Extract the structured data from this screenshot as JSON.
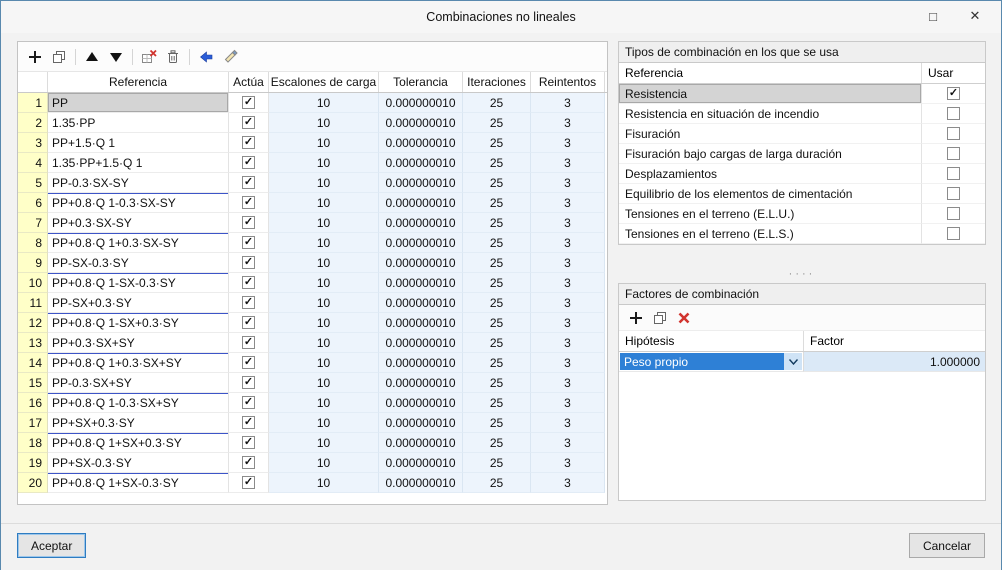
{
  "window": {
    "title": "Combinaciones no lineales",
    "maximize_icon": "□",
    "close_icon": "✕"
  },
  "colors": {
    "accent_blue": "#2e80d6",
    "row_number_bg": "#ffffc8",
    "selection_gray": "#d4d4d4",
    "boxed_border": "#3d55c8",
    "numeric_cell_bg": "#edf4fc"
  },
  "left": {
    "toolbar_icons": [
      "add-icon",
      "duplicate-icon",
      "move-up-icon",
      "move-down-icon",
      "delete-rows-icon",
      "trash-icon",
      "undo-arrow-icon",
      "format-painter-icon"
    ],
    "columns": {
      "referencia": "Referencia",
      "actua": "Actúa",
      "escalones": "Escalones de carga",
      "tolerancia": "Tolerancia",
      "iteraciones": "Iteraciones",
      "reintentos": "Reintentos"
    },
    "rows": [
      {
        "num": "1",
        "ref": "PP",
        "actua": true,
        "escalones": "10",
        "tolerancia": "0.000000010",
        "iteraciones": "25",
        "reintentos": "3",
        "boxed": false,
        "selected": true
      },
      {
        "num": "2",
        "ref": "1.35·PP",
        "actua": true,
        "escalones": "10",
        "tolerancia": "0.000000010",
        "iteraciones": "25",
        "reintentos": "3",
        "boxed": false,
        "selected": false
      },
      {
        "num": "3",
        "ref": "PP+1.5·Q 1",
        "actua": true,
        "escalones": "10",
        "tolerancia": "0.000000010",
        "iteraciones": "25",
        "reintentos": "3",
        "boxed": false,
        "selected": false
      },
      {
        "num": "4",
        "ref": "1.35·PP+1.5·Q 1",
        "actua": true,
        "escalones": "10",
        "tolerancia": "0.000000010",
        "iteraciones": "25",
        "reintentos": "3",
        "boxed": false,
        "selected": false
      },
      {
        "num": "5",
        "ref": "PP-0.3·SX-SY",
        "actua": true,
        "escalones": "10",
        "tolerancia": "0.000000010",
        "iteraciones": "25",
        "reintentos": "3",
        "boxed": false,
        "selected": false
      },
      {
        "num": "6",
        "ref": "PP+0.8·Q 1-0.3·SX-SY",
        "actua": true,
        "escalones": "10",
        "tolerancia": "0.000000010",
        "iteraciones": "25",
        "reintentos": "3",
        "boxed": true,
        "selected": false
      },
      {
        "num": "7",
        "ref": "PP+0.3·SX-SY",
        "actua": true,
        "escalones": "10",
        "tolerancia": "0.000000010",
        "iteraciones": "25",
        "reintentos": "3",
        "boxed": false,
        "selected": false
      },
      {
        "num": "8",
        "ref": "PP+0.8·Q 1+0.3·SX-SY",
        "actua": true,
        "escalones": "10",
        "tolerancia": "0.000000010",
        "iteraciones": "25",
        "reintentos": "3",
        "boxed": true,
        "selected": false
      },
      {
        "num": "9",
        "ref": "PP-SX-0.3·SY",
        "actua": true,
        "escalones": "10",
        "tolerancia": "0.000000010",
        "iteraciones": "25",
        "reintentos": "3",
        "boxed": false,
        "selected": false
      },
      {
        "num": "10",
        "ref": "PP+0.8·Q 1-SX-0.3·SY",
        "actua": true,
        "escalones": "10",
        "tolerancia": "0.000000010",
        "iteraciones": "25",
        "reintentos": "3",
        "boxed": true,
        "selected": false
      },
      {
        "num": "11",
        "ref": "PP-SX+0.3·SY",
        "actua": true,
        "escalones": "10",
        "tolerancia": "0.000000010",
        "iteraciones": "25",
        "reintentos": "3",
        "boxed": false,
        "selected": false
      },
      {
        "num": "12",
        "ref": "PP+0.8·Q 1-SX+0.3·SY",
        "actua": true,
        "escalones": "10",
        "tolerancia": "0.000000010",
        "iteraciones": "25",
        "reintentos": "3",
        "boxed": true,
        "selected": false
      },
      {
        "num": "13",
        "ref": "PP+0.3·SX+SY",
        "actua": true,
        "escalones": "10",
        "tolerancia": "0.000000010",
        "iteraciones": "25",
        "reintentos": "3",
        "boxed": false,
        "selected": false
      },
      {
        "num": "14",
        "ref": "PP+0.8·Q 1+0.3·SX+SY",
        "actua": true,
        "escalones": "10",
        "tolerancia": "0.000000010",
        "iteraciones": "25",
        "reintentos": "3",
        "boxed": true,
        "selected": false
      },
      {
        "num": "15",
        "ref": "PP-0.3·SX+SY",
        "actua": true,
        "escalones": "10",
        "tolerancia": "0.000000010",
        "iteraciones": "25",
        "reintentos": "3",
        "boxed": false,
        "selected": false
      },
      {
        "num": "16",
        "ref": "PP+0.8·Q 1-0.3·SX+SY",
        "actua": true,
        "escalones": "10",
        "tolerancia": "0.000000010",
        "iteraciones": "25",
        "reintentos": "3",
        "boxed": true,
        "selected": false
      },
      {
        "num": "17",
        "ref": "PP+SX+0.3·SY",
        "actua": true,
        "escalones": "10",
        "tolerancia": "0.000000010",
        "iteraciones": "25",
        "reintentos": "3",
        "boxed": false,
        "selected": false
      },
      {
        "num": "18",
        "ref": "PP+0.8·Q 1+SX+0.3·SY",
        "actua": true,
        "escalones": "10",
        "tolerancia": "0.000000010",
        "iteraciones": "25",
        "reintentos": "3",
        "boxed": true,
        "selected": false
      },
      {
        "num": "19",
        "ref": "PP+SX-0.3·SY",
        "actua": true,
        "escalones": "10",
        "tolerancia": "0.000000010",
        "iteraciones": "25",
        "reintentos": "3",
        "boxed": false,
        "selected": false
      },
      {
        "num": "20",
        "ref": "PP+0.8·Q 1+SX-0.3·SY",
        "actua": true,
        "escalones": "10",
        "tolerancia": "0.000000010",
        "iteraciones": "25",
        "reintentos": "3",
        "boxed": true,
        "selected": false
      }
    ]
  },
  "tipos": {
    "title": "Tipos de combinación en los que se usa",
    "columns": {
      "referencia": "Referencia",
      "usar": "Usar"
    },
    "rows": [
      {
        "label": "Resistencia",
        "checked": true,
        "selected": true
      },
      {
        "label": "Resistencia en situación de incendio",
        "checked": false,
        "selected": false
      },
      {
        "label": "Fisuración",
        "checked": false,
        "selected": false
      },
      {
        "label": "Fisuración bajo cargas de larga duración",
        "checked": false,
        "selected": false
      },
      {
        "label": "Desplazamientos",
        "checked": false,
        "selected": false
      },
      {
        "label": "Equilibrio de los elementos de cimentación",
        "checked": false,
        "selected": false
      },
      {
        "label": "Tensiones en el terreno (E.L.U.)",
        "checked": false,
        "selected": false
      },
      {
        "label": "Tensiones en el terreno (E.L.S.)",
        "checked": false,
        "selected": false
      }
    ]
  },
  "factores": {
    "title": "Factores de combinación",
    "toolbar_icons": [
      "add-icon",
      "duplicate-icon",
      "delete-icon"
    ],
    "columns": {
      "hipotesis": "Hipótesis",
      "factor": "Factor"
    },
    "rows": [
      {
        "hipotesis": "Peso propio",
        "factor": "1.000000"
      }
    ]
  },
  "footer": {
    "accept": "Aceptar",
    "cancel": "Cancelar"
  }
}
